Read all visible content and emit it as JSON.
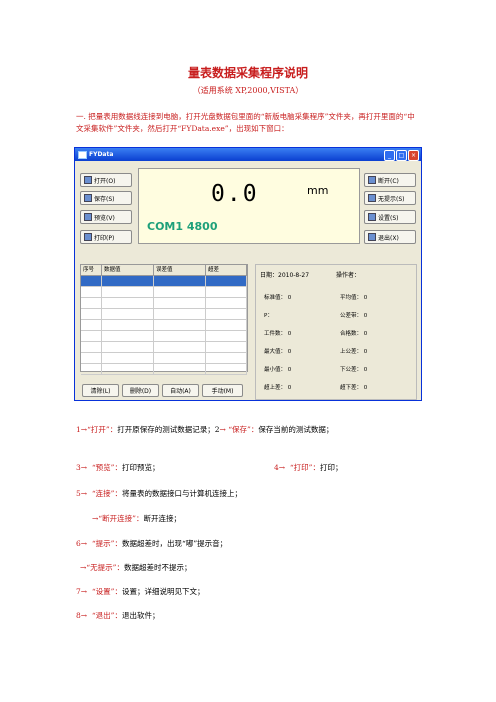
{
  "doc": {
    "title": "量表数据采集程序说明",
    "subtitle": "（适用系统 XP,2000,VISTA）",
    "intro": "一. 把量表用数据线连接到电脑，打开光盘数据包里面的“新版电脑采集程序”文件夹，再打开里面的“中文采集软件”文件夹，然后打开“FYData.exe”，出现如下窗口："
  },
  "window": {
    "title": "FYData",
    "reading": "0.0",
    "unit": "mm",
    "port": "COM1  4800",
    "left_buttons": [
      "打开(O)",
      "保存(S)",
      "预览(V)",
      "打印(P)"
    ],
    "right_buttons": [
      "断开(C)",
      "无提示(S)",
      "设置(S)",
      "退出(X)"
    ],
    "grid_headers": [
      "序号",
      "数据值",
      "误差值",
      "超差"
    ],
    "bottom_buttons": [
      "清除(L)",
      "删除(D)",
      "自动(A)",
      "手动(M)"
    ],
    "date": "日期：2010-8-27",
    "operator": "操作者：",
    "stats": [
      {
        "label": "标准值：",
        "value": "0"
      },
      {
        "label": "平均值：",
        "value": "0"
      },
      {
        "label": "P：",
        "value": ""
      },
      {
        "label": "公差带：",
        "value": "0"
      },
      {
        "label": "工件数：",
        "value": "0"
      },
      {
        "label": "合格数：",
        "value": "0"
      },
      {
        "label": "最大值：",
        "value": "0"
      },
      {
        "label": "上公差：",
        "value": "0"
      },
      {
        "label": "最小值：",
        "value": "0"
      },
      {
        "label": "下公差：",
        "value": "0"
      },
      {
        "label": "超上差：",
        "value": "0"
      },
      {
        "label": "超下差：",
        "value": "0"
      }
    ]
  },
  "items": [
    {
      "num": "1",
      "label": "“打开”：",
      "desc": "打开原保存的测试数据记录；2",
      "label2": " “保存”：",
      "desc2": "保存当前的测试数据；"
    },
    {
      "num": "3",
      "label": "“预览”：",
      "desc": "打印预览；",
      "num2": "4",
      "label2": "“打印”：",
      "desc2": "打印；"
    },
    {
      "num": "5",
      "label": "“连接”：",
      "desc": "将量表的数据接口与计算机连接上；"
    },
    {
      "label": "“断开连接”：",
      "desc": "断开连接；"
    },
    {
      "num": "6",
      "label": "“提示”：",
      "desc": "数据超差时，出现“嘟”提示音；"
    },
    {
      "label": "“无提示”：",
      "desc": "数据超差时不提示；"
    },
    {
      "num": "7",
      "label": "“设置”：",
      "desc": "设置；详细说明见下文；"
    },
    {
      "num": "8",
      "label": "“退出”：",
      "desc": "退出软件；"
    }
  ],
  "colors": {
    "heading": "#c81e1e",
    "window_frame": "#0831d9",
    "port_text": "#1ea07a"
  }
}
